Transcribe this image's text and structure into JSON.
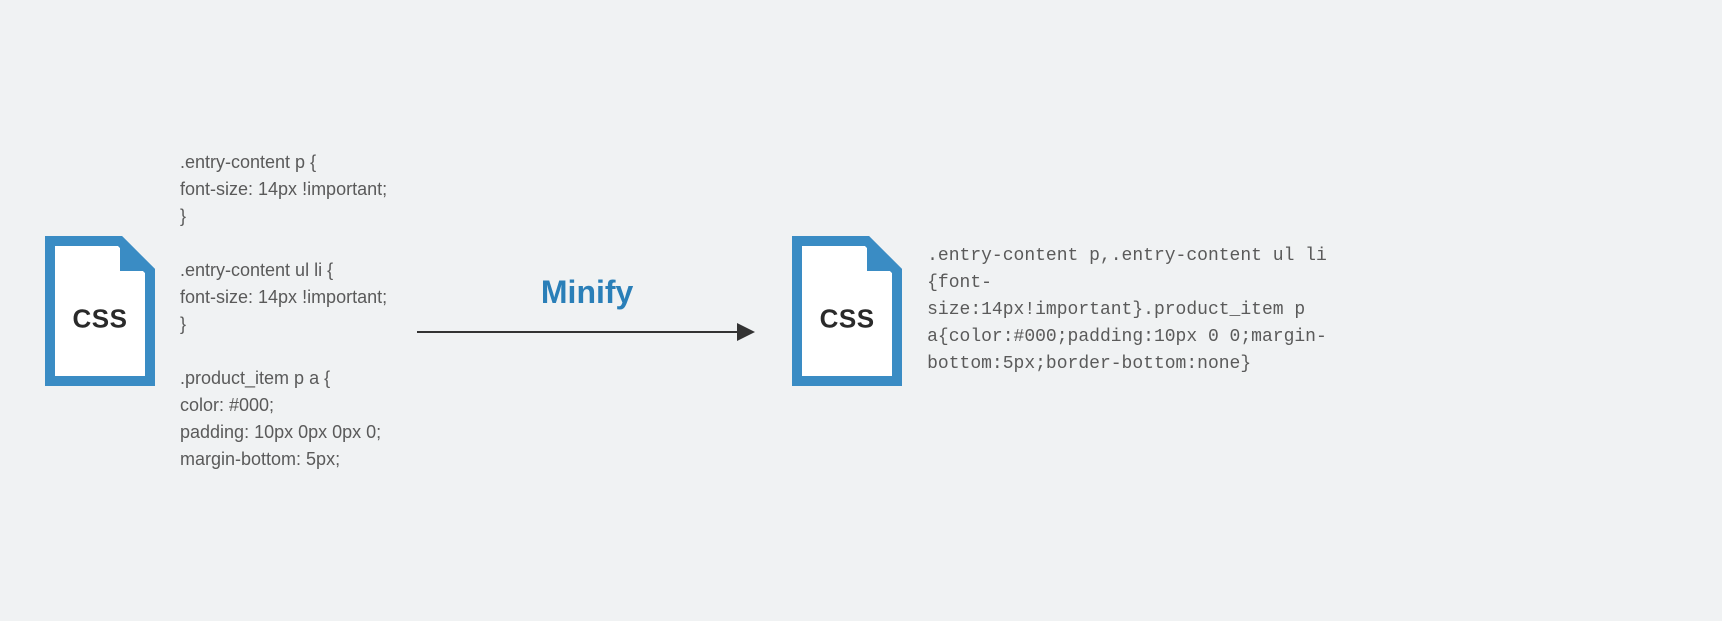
{
  "left": {
    "file_label": "CSS",
    "code": ".entry-content p {\nfont-size: 14px !important;\n}\n\n.entry-content ul li {\nfont-size: 14px !important;\n}\n\n.product_item p a {\ncolor: #000;\npadding: 10px 0px 0px 0;\nmargin-bottom: 5px;"
  },
  "arrow": {
    "label": "Minify"
  },
  "right": {
    "file_label": "CSS",
    "code": ".entry-content p,.entry-content ul li {font-size:14px!important}.product_item p a{color:#000;padding:10px 0 0;margin-bottom:5px;border-bottom:none}"
  },
  "colors": {
    "accent": "#2a7fb8",
    "text": "#5a5a5a",
    "bg": "#f0f2f3"
  }
}
